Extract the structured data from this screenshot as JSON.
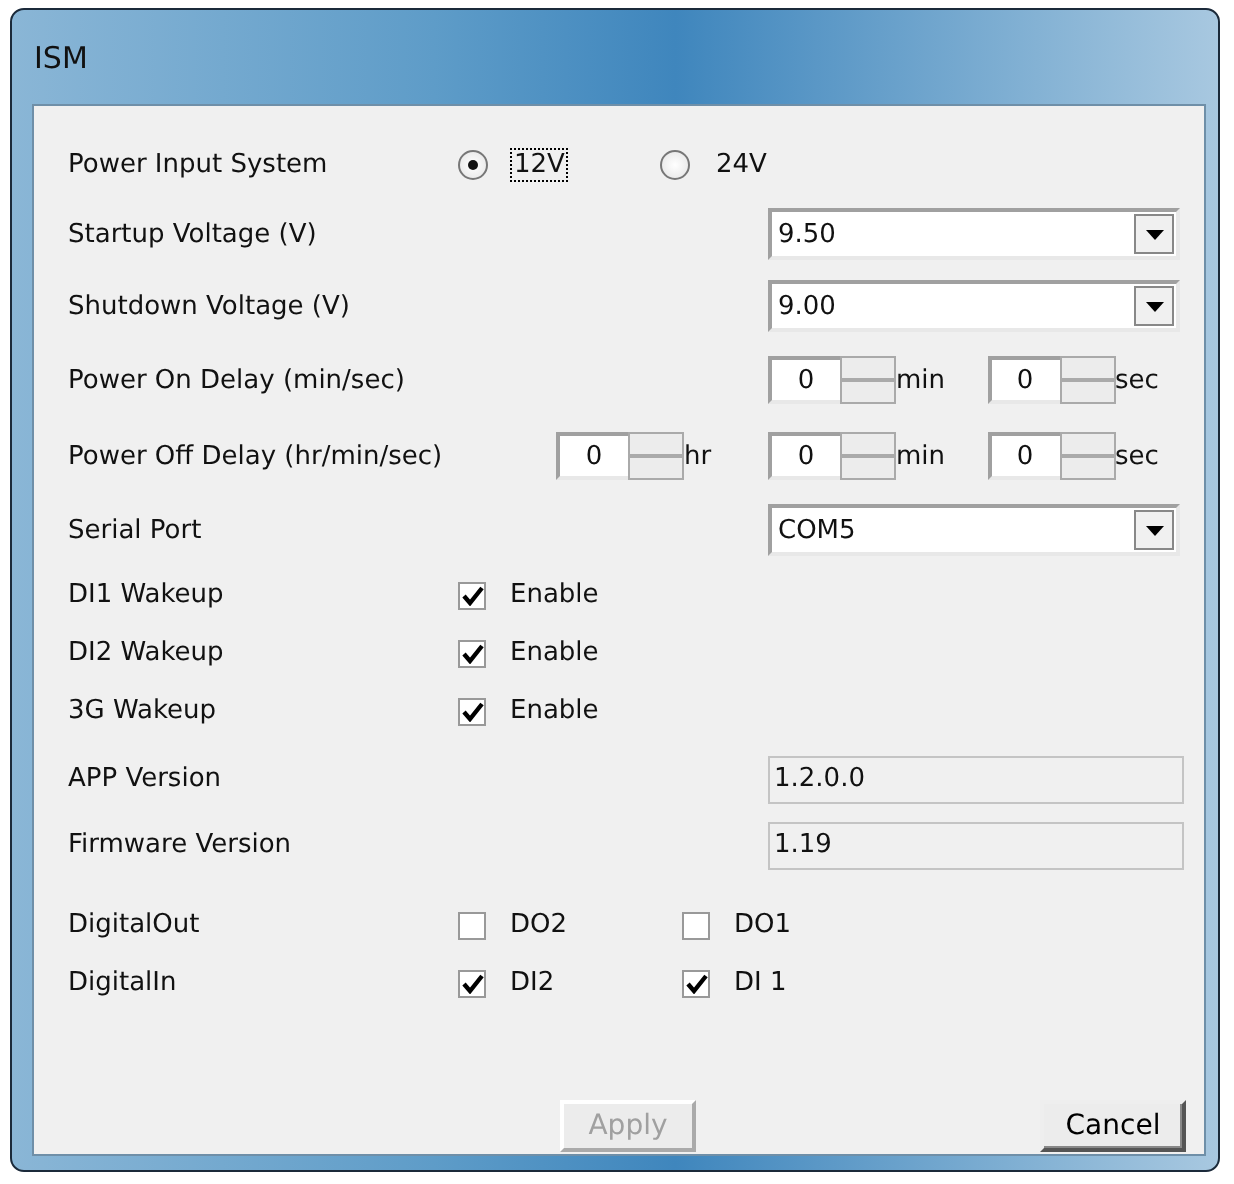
{
  "window": {
    "title": "ISM"
  },
  "rows": [
    {
      "kind": "radio",
      "label": "Power Input System",
      "options": [
        {
          "label": "12V",
          "selected": true,
          "focused": true
        },
        {
          "label": "24V",
          "selected": false,
          "focused": false
        }
      ]
    },
    {
      "kind": "combo",
      "label": "Startup Voltage (V)",
      "value": "9.50"
    },
    {
      "kind": "combo",
      "label": "Shutdown Voltage (V)",
      "value": "9.00"
    },
    {
      "kind": "spinners",
      "label": "Power On Delay (min/sec)",
      "spinners": [
        {
          "value": "0",
          "unit": "min"
        },
        {
          "value": "0",
          "unit": "sec"
        }
      ]
    },
    {
      "kind": "spinners",
      "label": "Power Off Delay (hr/min/sec)",
      "spinners": [
        {
          "value": "0",
          "unit": "hr"
        },
        {
          "value": "0",
          "unit": "min"
        },
        {
          "value": "0",
          "unit": "sec"
        }
      ]
    },
    {
      "kind": "combo",
      "label": "Serial Port",
      "value": "COM5"
    },
    {
      "kind": "checks",
      "label": "DI1 Wakeup",
      "checks": [
        {
          "label": "Enable",
          "checked": true
        }
      ]
    },
    {
      "kind": "checks",
      "label": "DI2 Wakeup",
      "checks": [
        {
          "label": "Enable",
          "checked": true
        }
      ]
    },
    {
      "kind": "checks",
      "label": "3G Wakeup",
      "checks": [
        {
          "label": "Enable",
          "checked": true
        }
      ]
    },
    {
      "kind": "readonly",
      "label": "APP Version",
      "value": "1.2.0.0"
    },
    {
      "kind": "readonly",
      "label": "Firmware Version",
      "value": "1.19"
    },
    {
      "kind": "checks",
      "label": "DigitalOut",
      "checks": [
        {
          "label": "DO2",
          "checked": false
        },
        {
          "label": "DO1",
          "checked": false
        }
      ]
    },
    {
      "kind": "checks",
      "label": "DigitalIn",
      "checks": [
        {
          "label": "DI2",
          "checked": true
        },
        {
          "label": "DI 1",
          "checked": true
        }
      ]
    }
  ],
  "buttons": [
    {
      "label": "Apply",
      "disabled": true
    },
    {
      "label": "Cancel",
      "disabled": false
    }
  ]
}
